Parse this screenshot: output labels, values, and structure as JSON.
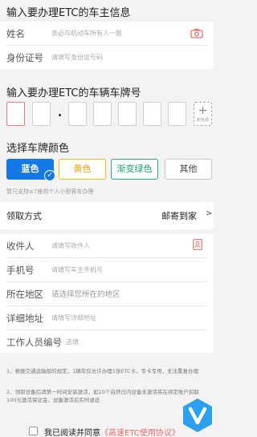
{
  "owner_section": {
    "title": "输入要办理ETC的车主信息",
    "name_label": "姓名",
    "name_placeholder": "务必与机动车所有人一致",
    "camera_icon": "camera-icon",
    "id_label": "身份证号",
    "id_placeholder": "请填写身份证号码"
  },
  "plate_section": {
    "title": "输入要办理ETC的车辆车牌号",
    "new_energy_plus": "+",
    "new_energy_label": "新能源"
  },
  "color_section": {
    "title": "选择车牌颜色",
    "options": [
      "蓝色",
      "黄色",
      "渐变绿色",
      "其他"
    ],
    "selected": "蓝色",
    "selected_check": "✓",
    "note": "暂只支持≤7座的个人小型客车办理",
    "colors": {
      "blue": "#1479e4",
      "yellow": "#f0c000",
      "green": "#19b87c",
      "accent_red": "#f06b6b"
    }
  },
  "delivery": {
    "label": "领取方式",
    "value": "邮寄到家",
    "arrow": ">"
  },
  "address_form": {
    "recipient_label": "收件人",
    "recipient_placeholder": "请填写收件人",
    "phone_label": "手机号",
    "phone_placeholder": "请填写车主手机号",
    "region_label": "所在地区",
    "region_placeholder": "请选择您所在的地区",
    "detail_label": "详细地址",
    "detail_placeholder": "请填写详细地址",
    "staff_label": "工作人员编号",
    "staff_placeholder": "选填"
  },
  "notices": {
    "n1": "1、根据交通运输部的规定，1辆车仅允许办理1张ETC卡，专卡专用，无法重复办理",
    "n2": "2、领取设备后请第一时间安装激活，如10个自然日内设备未激活将在绑定账户扣取100元激活保证金，设备激活后实时退还"
  },
  "agreement": {
    "prefix": "我已阅读并同意",
    "link": "《高速ETC使用协议》"
  }
}
